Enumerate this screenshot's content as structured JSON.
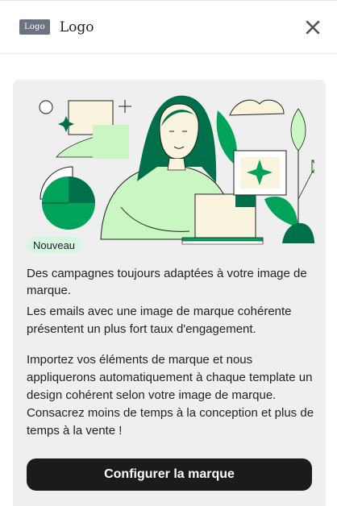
{
  "header": {
    "logo_badge": "Logo",
    "logo_text": "Logo",
    "close_icon": "close-icon"
  },
  "card": {
    "badge": "Nouveau",
    "headline": "Des campagnes toujours adaptées à votre image de marque.",
    "paragraph1": "Les emails avec une image de marque cohérente présentent un plus fort taux d'engagement.",
    "paragraph2": "Importez vos éléments de marque et nous appliquerons automatiquement à chaque template un design cohérent selon votre image de marque. Consacrez moins de temps à la conception et plus de temps à la vente !",
    "cta_label": "Configurer la marque"
  },
  "colors": {
    "dark_green": "#00704a",
    "mid_green": "#00a35a",
    "light_green": "#c9f6c3",
    "cream": "#faf3dd",
    "card_bg": "#efefef",
    "button_bg": "#1b1b1b"
  }
}
